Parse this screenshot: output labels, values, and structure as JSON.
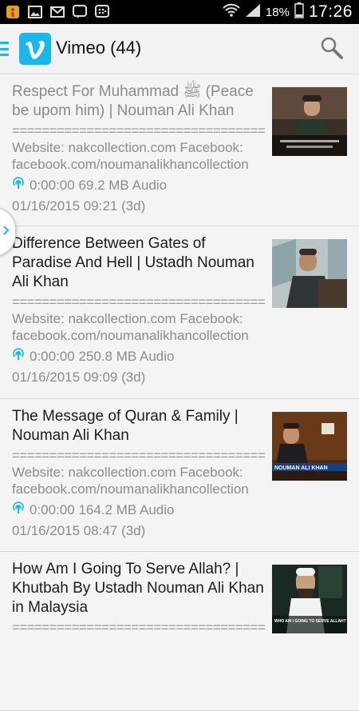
{
  "status_bar": {
    "battery_percent": "18%",
    "time": "17:26",
    "icons": [
      "notification-icon",
      "image-icon",
      "gmail-icon",
      "chat-icon",
      "bbm-icon",
      "wifi-icon",
      "signal-icon",
      "battery-icon"
    ]
  },
  "action_bar": {
    "title": "Vimeo (44)",
    "icons": [
      "menu-icon",
      "vimeo-logo",
      "search-icon"
    ]
  },
  "colors": {
    "accent": "#1ab7ea",
    "read_title": "#8a8a8a",
    "title": "#1c1c1c"
  },
  "feed": [
    {
      "title": "Respect For Muhammad ﷺ (Peace be upom him) | Nouman Ali Khan",
      "separator": "=====================================",
      "description": "Website: nakcollection.com Facebook: facebook.com/noumanalikhancollection",
      "meta": "0:00:00 69.2 MB Audio",
      "date": "01/16/2015 09:21 (3d)",
      "read": true
    },
    {
      "title": "Difference Between Gates of Paradise And Hell | Ustadh Nouman Ali Khan",
      "separator": "=====================================",
      "description": "Website: nakcollection.com Facebook: facebook.com/noumanalikhancollection",
      "meta": "0:00:00 250.8 MB Audio",
      "date": "01/16/2015 09:09 (3d)",
      "read": false
    },
    {
      "title": "The Message of Quran & Family | Nouman Ali Khan",
      "separator": "=====================================",
      "description": "Website: nakcollection.com Facebook: facebook.com/noumanalikhancollection",
      "meta": "0:00:00 164.2 MB Audio",
      "date": "01/16/2015 08:47 (3d)",
      "read": false,
      "thumb_caption": "NOUMAN ALI KHAN"
    },
    {
      "title": "How Am I Going To Serve Allah? | Khutbah By Ustadh Nouman Ali Khan in Malaysia",
      "separator": "=====================================",
      "read": false,
      "thumb_caption": "WHO AM I GOING TO SERVE ALLAH?"
    }
  ]
}
